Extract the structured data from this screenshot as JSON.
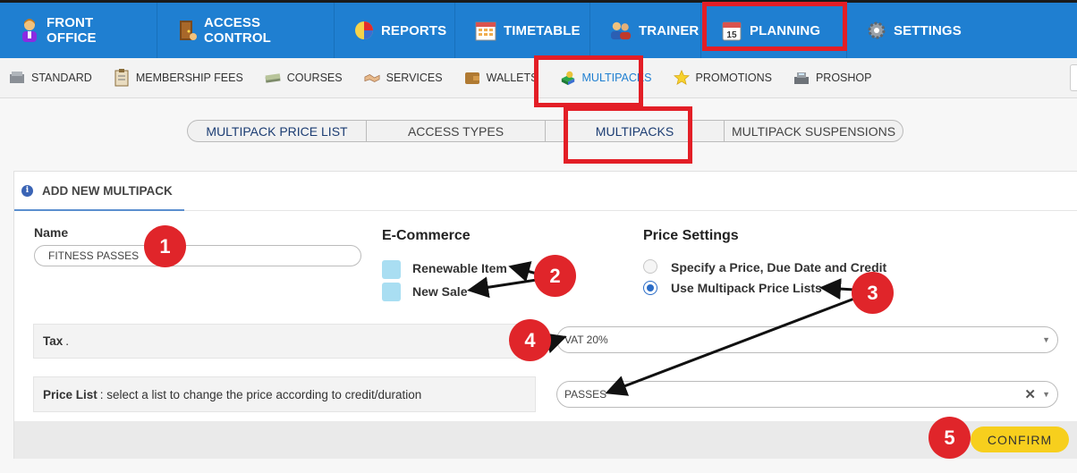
{
  "topnav": [
    {
      "label": "FRONT OFFICE",
      "icon": "receptionist-icon"
    },
    {
      "label": "ACCESS CONTROL",
      "icon": "door-access-icon"
    },
    {
      "label": "REPORTS",
      "icon": "pie-chart-icon"
    },
    {
      "label": "TIMETABLE",
      "icon": "calendar-grid-icon"
    },
    {
      "label": "TRAINER",
      "icon": "people-icon"
    },
    {
      "label": "PLANNING",
      "icon": "calendar-15-icon",
      "calendar_day": "15"
    },
    {
      "label": "SETTINGS",
      "icon": "gear-icon"
    }
  ],
  "subnav": [
    {
      "label": "STANDARD",
      "icon": "boxes-icon"
    },
    {
      "label": "MEMBERSHIP FEES",
      "icon": "clipboard-icon"
    },
    {
      "label": "COURSES",
      "icon": "money-stack-icon"
    },
    {
      "label": "SERVICES",
      "icon": "handshake-icon"
    },
    {
      "label": "WALLETS",
      "icon": "wallet-icon"
    },
    {
      "label": "MULTIPACKS",
      "icon": "multipack-icon"
    },
    {
      "label": "PROMOTIONS",
      "icon": "star-icon"
    },
    {
      "label": "PROSHOP",
      "icon": "cash-register-icon"
    }
  ],
  "tabs": [
    "MULTIPACK PRICE LIST",
    "ACCESS TYPES",
    "MULTIPACKS",
    "MULTIPACK SUSPENSIONS"
  ],
  "panel": {
    "title": "ADD NEW MULTIPACK",
    "info_glyph": "i",
    "name_label": "Name",
    "name_value": "FITNESS PASSES",
    "ecommerce": {
      "title": "E-Commerce",
      "renewable": "Renewable Item",
      "new_sale": "New Sale"
    },
    "price_settings": {
      "title": "Price Settings",
      "option1": "Specify a Price, Due Date and Credit",
      "option2": "Use Multipack Price Lists",
      "selected": 2
    },
    "tax": {
      "label": "Tax",
      "suffix": ".",
      "value": "VAT 20%"
    },
    "price_list": {
      "label": "Price List",
      "hint": ": select a list to change the price according to credit/duration",
      "value": "PASSES"
    },
    "confirm": "CONFIRM"
  },
  "badges": [
    "1",
    "2",
    "3",
    "4",
    "5"
  ],
  "colors": {
    "nav_blue": "#1f7fd1",
    "highlight_red": "#e31e26",
    "badge_red": "#e0252a",
    "confirm_yellow": "#f7cf1d",
    "checkbox": "#a9def2"
  }
}
